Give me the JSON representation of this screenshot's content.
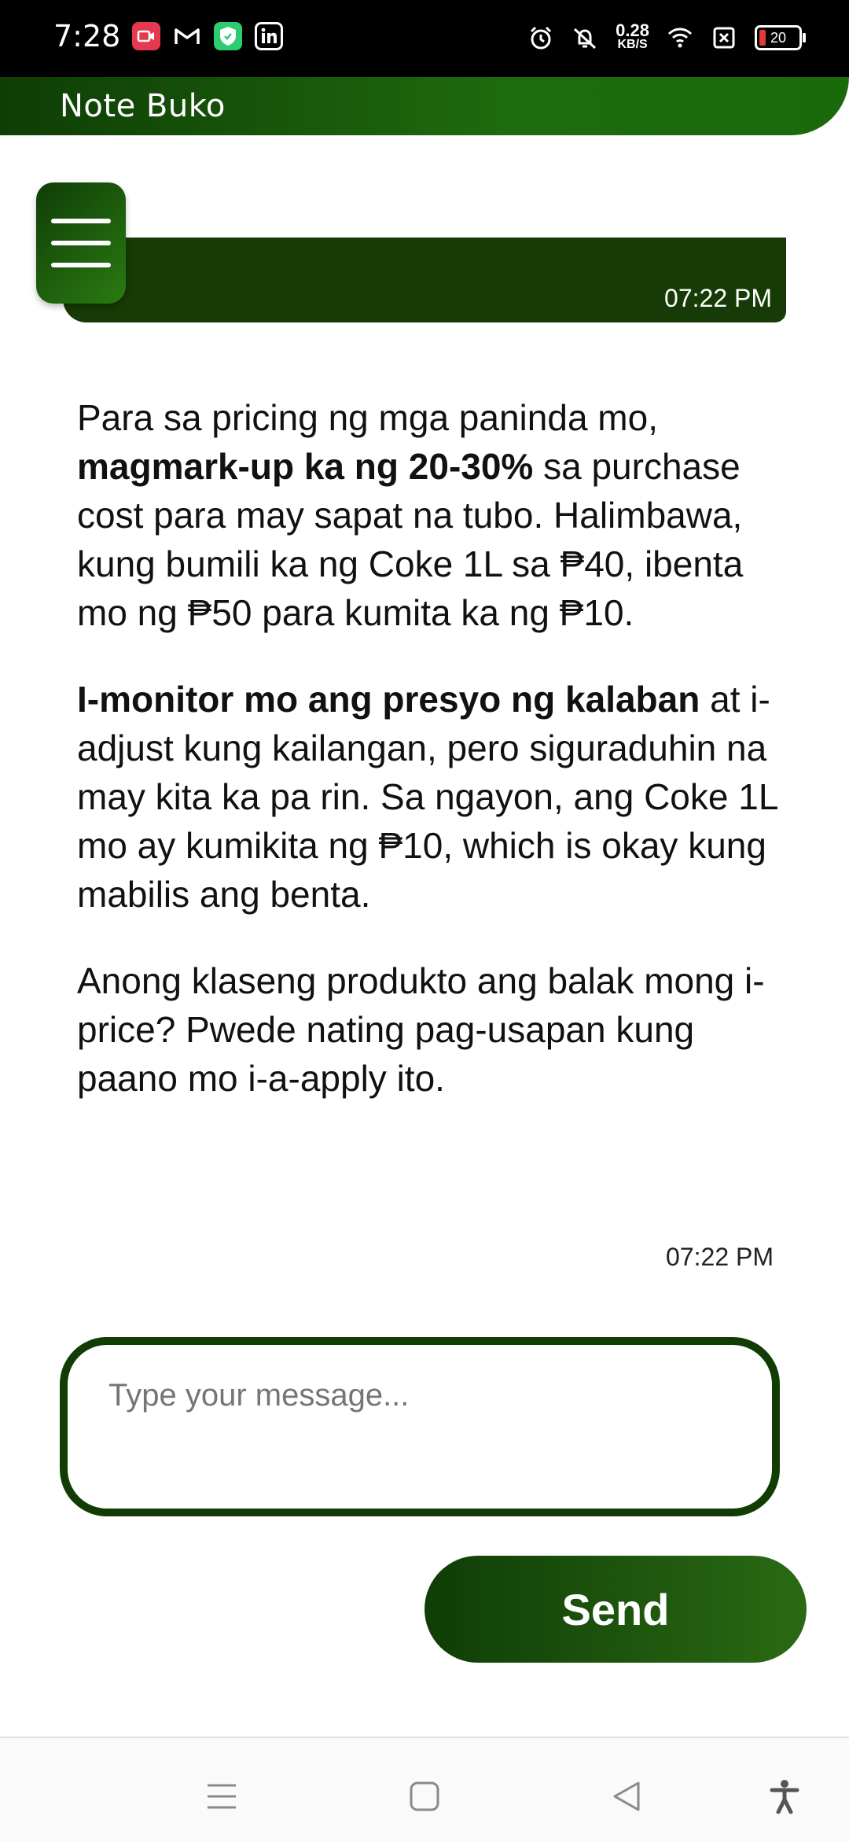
{
  "status_bar": {
    "time": "7:28",
    "speed_value": "0.28",
    "speed_unit": "KB/S",
    "battery": "20",
    "apps": [
      {
        "name": "video-app-icon",
        "color": "#e53950"
      },
      {
        "name": "gmail-icon",
        "color": "#ffffff"
      },
      {
        "name": "shield-app-icon",
        "color": "#2ecc71"
      },
      {
        "name": "linkedin-icon",
        "color": "#ffffff"
      }
    ]
  },
  "app_bar": {
    "title": "Note Buko"
  },
  "previous_message": {
    "time": "07:22 PM"
  },
  "assistant_message": {
    "paragraphs": [
      {
        "pre": "Para sa pricing ng mga paninda mo, ",
        "bold": "magmark-up ka ng 20-30%",
        "post": " sa purchase cost para may sapat na tubo. Halimbawa, kung bumili ka ng Coke 1L sa ₱40, ibenta mo ng ₱50 para kumita ka ng ₱10."
      },
      {
        "pre": "",
        "bold": "I-monitor mo ang presyo ng kalaban",
        "post": " at i-adjust kung kailangan, pero siguraduhin na may kita ka pa rin. Sa ngayon, ang Coke 1L mo ay kumikita ng ₱10, which is okay kung mabilis ang benta."
      },
      {
        "pre": "Anong klaseng produkto ang balak mong i-price? Pwede nating pag-usapan kung paano mo i-a-apply ito.",
        "bold": "",
        "post": ""
      }
    ],
    "time": "07:22 PM"
  },
  "composer": {
    "placeholder": "Type your message...",
    "send_label": "Send"
  },
  "colors": {
    "primary": "#113d05",
    "accent": "#1e6b0e"
  }
}
